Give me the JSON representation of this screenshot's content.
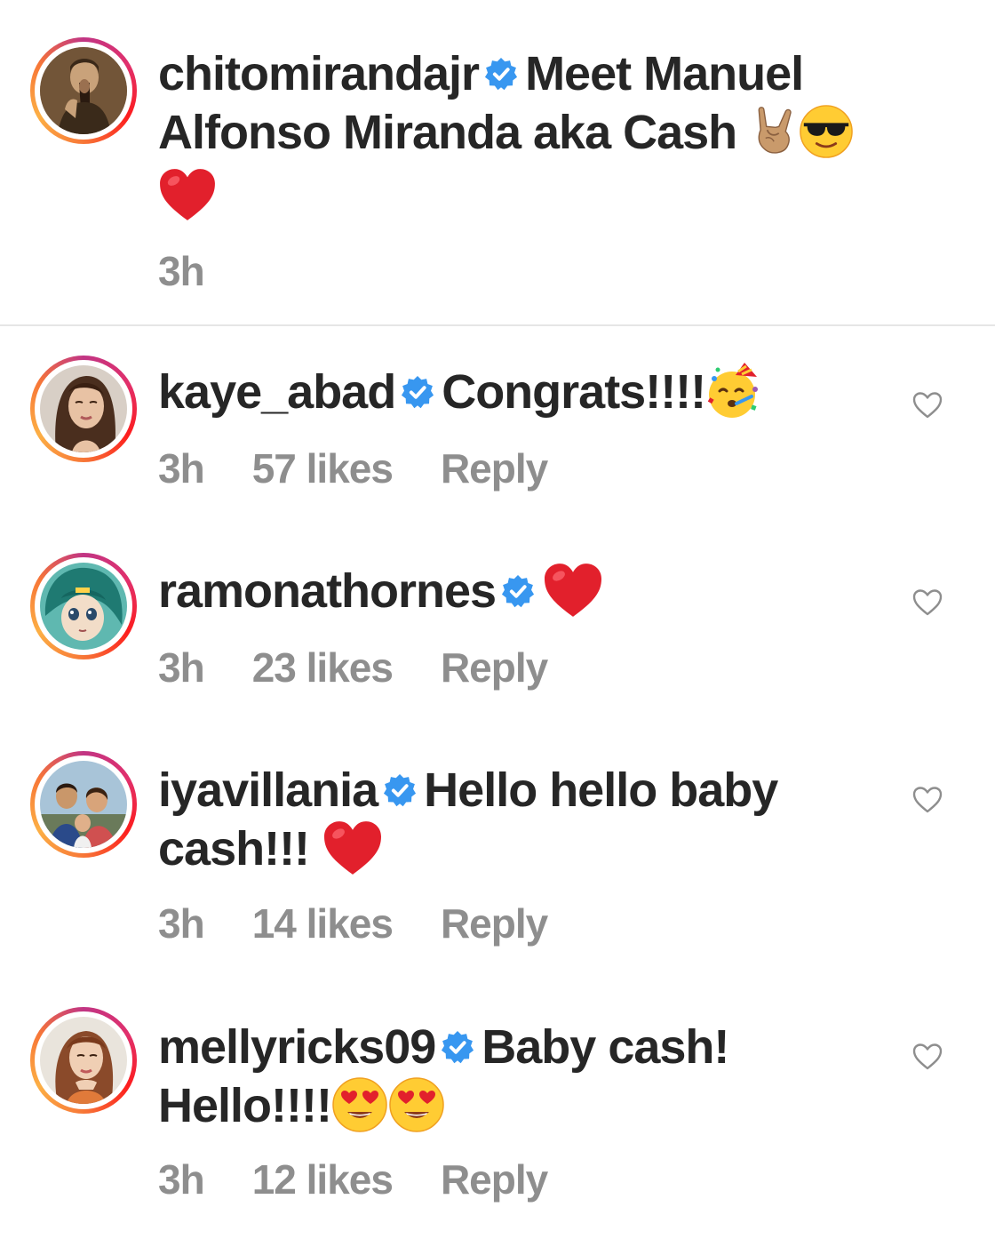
{
  "caption": {
    "username": "chitomirandajr",
    "text": "Meet Manuel Alfonso Miranda aka Cash",
    "time": "3h"
  },
  "comments": [
    {
      "username": "kaye_abad",
      "text": "Congrats!!!!",
      "time": "3h",
      "likes": "57 likes",
      "reply": "Reply"
    },
    {
      "username": "ramonathornes",
      "text": "",
      "time": "3h",
      "likes": "23 likes",
      "reply": "Reply"
    },
    {
      "username": "iyavillania",
      "text": "Hello hello baby cash!!!",
      "time": "3h",
      "likes": "14 likes",
      "reply": "Reply"
    },
    {
      "username": "mellyricks09",
      "text": "Baby cash! Hello!!!!",
      "time": "3h",
      "likes": "12 likes",
      "reply": "Reply"
    }
  ],
  "colors": {
    "verified": "#3897f0",
    "meta_text": "#8e8e8e",
    "heart": "#e2202c"
  },
  "icons": [
    "verified-badge-icon",
    "heart-outline-icon",
    "heart-emoji",
    "horns-hand-emoji",
    "sunglasses-emoji",
    "party-face-emoji",
    "heart-eyes-emoji"
  ]
}
